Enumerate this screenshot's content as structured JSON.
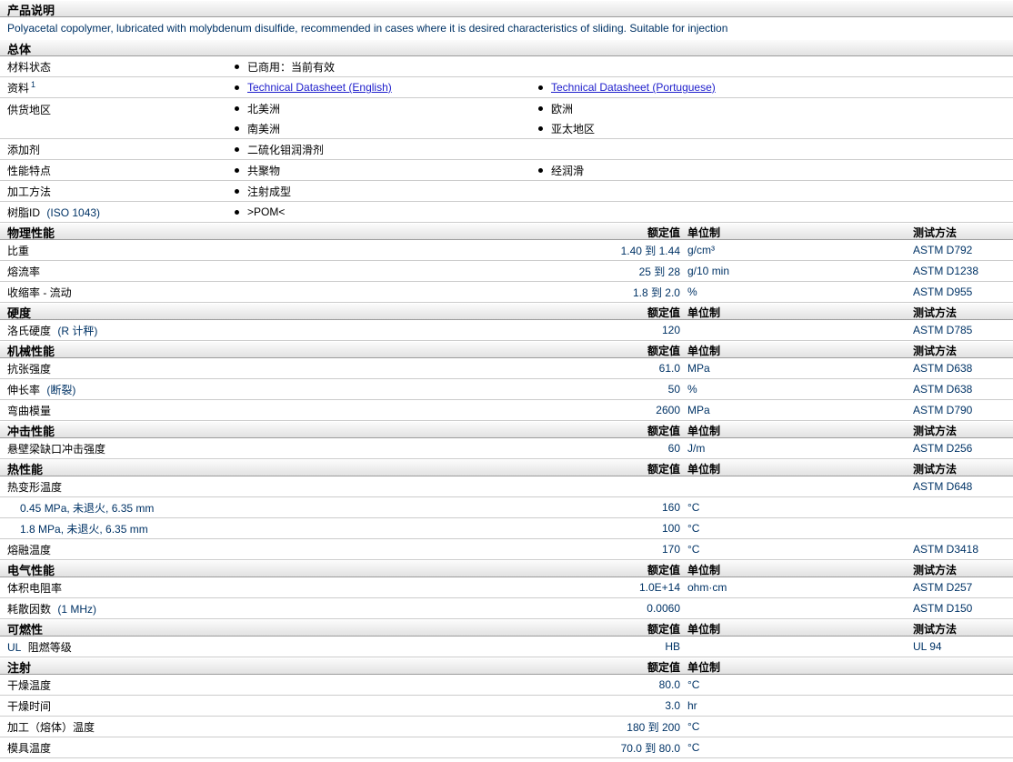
{
  "header": {
    "title": "产品说明",
    "description": "Polyacetal copolymer, lubricated with molybdenum disulfide, recommended in cases where it is desired characteristics of sliding. Suitable for injection"
  },
  "columns": {
    "value": "额定值",
    "unit": "单位制",
    "method": "测试方法"
  },
  "colors": {
    "data_text": "#003366",
    "link": "#2020cc",
    "header_bar_bg": "#e2e2e2",
    "row_border": "#cccccc",
    "bar_bottom_border": "#9c9c9c"
  },
  "general": {
    "title": "总体",
    "rows": {
      "status": {
        "label": "材料状态",
        "value": "已商用：当前有效"
      },
      "docs": {
        "label": "资料",
        "sup": "1",
        "link_english": "Technical Datasheet (English)",
        "link_portuguese": "Technical Datasheet (Portuguese)"
      },
      "regions": {
        "label": "供货地区",
        "col1_item1": "北美洲",
        "col1_item2": "南美洲",
        "col2_item1": "欧洲",
        "col2_item2": "亚太地区"
      },
      "additive": {
        "label": "添加剂",
        "value": "二硫化钼润滑剂"
      },
      "features": {
        "label": "性能特点",
        "value1": "共聚物",
        "value2": "经润滑"
      },
      "processing": {
        "label": "加工方法",
        "value": "注射成型"
      },
      "resin_id": {
        "label": "树脂ID",
        "cond": "(ISO 1043)",
        "value": ">POM<"
      }
    }
  },
  "sections": {
    "physical": {
      "title": "物理性能",
      "rows": {
        "gravity": {
          "label": "比重",
          "value": "1.40 到 1.44",
          "unit": "g/cm³",
          "method": "ASTM D792"
        },
        "melt_flow": {
          "label": "熔流率",
          "value": "25 到 28",
          "unit": "g/10 min",
          "method": "ASTM D1238"
        },
        "shrinkage": {
          "label": "收缩率 - 流动",
          "value": "1.8 到 2.0",
          "unit": "%",
          "method": "ASTM D955"
        }
      }
    },
    "hardness": {
      "title": "硬度",
      "rows": {
        "rockwell": {
          "label": "洛氏硬度",
          "cond": "(R 计秤)",
          "value": "120",
          "unit": "",
          "method": "ASTM D785"
        }
      }
    },
    "mechanical": {
      "title": "机械性能",
      "rows": {
        "tensile": {
          "label": "抗张强度",
          "value": "61.0",
          "unit": "MPa",
          "method": "ASTM D638"
        },
        "elongation": {
          "label": "伸长率",
          "cond": "(断裂)",
          "value": "50",
          "unit": "%",
          "method": "ASTM D638"
        },
        "flexural": {
          "label": "弯曲模量",
          "value": "2600",
          "unit": "MPa",
          "method": "ASTM D790"
        }
      }
    },
    "impact": {
      "title": "冲击性能",
      "rows": {
        "izod": {
          "label": "悬壁梁缺口冲击强度",
          "value": "60",
          "unit": "J/m",
          "method": "ASTM D256"
        }
      }
    },
    "thermal": {
      "title": "热性能",
      "rows": {
        "hdt": {
          "label": "热变形温度",
          "value": "",
          "unit": "",
          "method": "ASTM D648"
        },
        "hdt_045": {
          "label": "0.45 MPa, 未退火, 6.35 mm",
          "value": "160",
          "unit": "°C",
          "method": ""
        },
        "hdt_18": {
          "label": "1.8 MPa, 未退火, 6.35 mm",
          "value": "100",
          "unit": "°C",
          "method": ""
        },
        "melting": {
          "label": "熔融温度",
          "value": "170",
          "unit": "°C",
          "method": "ASTM D3418"
        }
      }
    },
    "electrical": {
      "title": "电气性能",
      "rows": {
        "resistivity": {
          "label": "体积电阻率",
          "value": "1.0E+14",
          "unit": "ohm·cm",
          "method": "ASTM D257"
        },
        "dissipation": {
          "label": "耗散因数",
          "cond": "(1 MHz)",
          "value": "0.0060",
          "unit": "",
          "method": "ASTM D150"
        }
      }
    },
    "flammability": {
      "title": "可燃性",
      "rows": {
        "ul_rating": {
          "pre": "UL",
          "label": "阻燃等级",
          "value": "HB",
          "unit": "",
          "method": "UL 94"
        }
      }
    },
    "injection": {
      "title": "注射",
      "rows": {
        "drying_temp": {
          "label": "干燥温度",
          "value": "80.0",
          "unit": "°C"
        },
        "drying_time": {
          "label": "干燥时间",
          "value": "3.0",
          "unit": "hr"
        },
        "processing_temp": {
          "label": "加工（熔体）温度",
          "value": "180 到 200",
          "unit": "°C"
        },
        "mold_temp": {
          "label": "模具温度",
          "value": "70.0 到 80.0",
          "unit": "°C"
        }
      }
    }
  }
}
